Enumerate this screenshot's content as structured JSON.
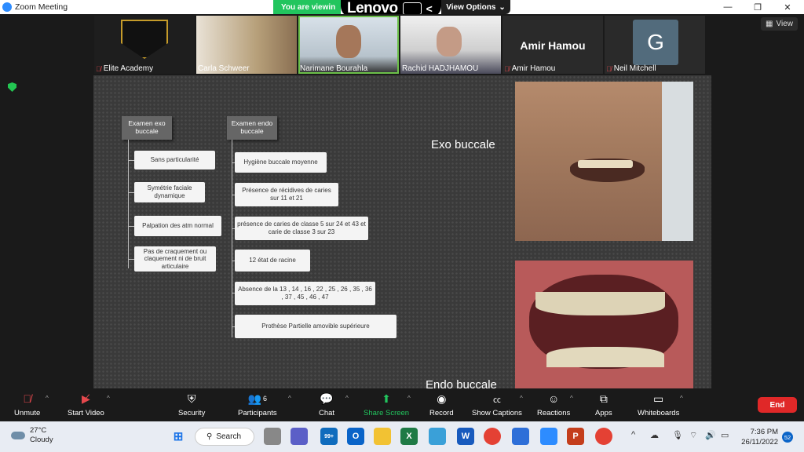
{
  "window": {
    "title": "Zoom Meeting",
    "minimize": "—",
    "restore": "❐",
    "close": "✕"
  },
  "banner": {
    "viewing": "You are viewin",
    "lenovo": "Lenovo",
    "view_options": "View Options",
    "back": "<"
  },
  "top_right": {
    "view_label": "View"
  },
  "participants_strip": [
    {
      "name": "Elite Academy",
      "muted": true
    },
    {
      "name": "Carla Schweer",
      "muted": false
    },
    {
      "name": "Narimane Bourahla",
      "muted": false,
      "active": true
    },
    {
      "name": "Rachid HADJHAMOU",
      "muted": false
    },
    {
      "name": "Amir Hamou",
      "muted": true,
      "display": "Amir Hamou"
    },
    {
      "name": "Neil Mitchell",
      "muted": true,
      "avatar_letter": "G"
    }
  ],
  "slide": {
    "exo_heading": "Examen exo buccale",
    "endo_heading": "Examen endo buccale",
    "exo_items": [
      "Sans particularité",
      "Symétrie faciale dynamique",
      "Palpation des atm normal",
      "Pas de craquement ou claquement ni de bruit articulaire"
    ],
    "endo_items": [
      "Hygiène buccale moyenne",
      "Présence de récidives de caries sur 11 et 21",
      "présence de caries de classe 5 sur 24 et 43 et carie de classe 3 sur 23",
      "12 état de racine",
      "Absence de la 13 , 14 , 16 , 22 , 25 , 26 , 35 , 36 , 37 , 45 , 46 , 47",
      "Prothèse Partielle amovible supérieure"
    ],
    "exo_label": "Exo buccale",
    "endo_label": "Endo buccale"
  },
  "toolbar": {
    "unmute": "Unmute",
    "start_video": "Start Video",
    "security": "Security",
    "participants": "Participants",
    "participant_count": "6",
    "chat": "Chat",
    "share_screen": "Share Screen",
    "record": "Record",
    "show_captions": "Show Captions",
    "reactions": "Reactions",
    "apps": "Apps",
    "whiteboards": "Whiteboards",
    "end": "End"
  },
  "taskbar": {
    "temperature": "27°C",
    "weather": "Cloudy",
    "search": "Search",
    "mail_badge": "99+",
    "time": "7:36 PM",
    "date": "26/11/2022",
    "notifications": "52"
  },
  "colors": {
    "accent": "#2d8cff",
    "share_green": "#22c55e",
    "end_red": "#e02828"
  }
}
